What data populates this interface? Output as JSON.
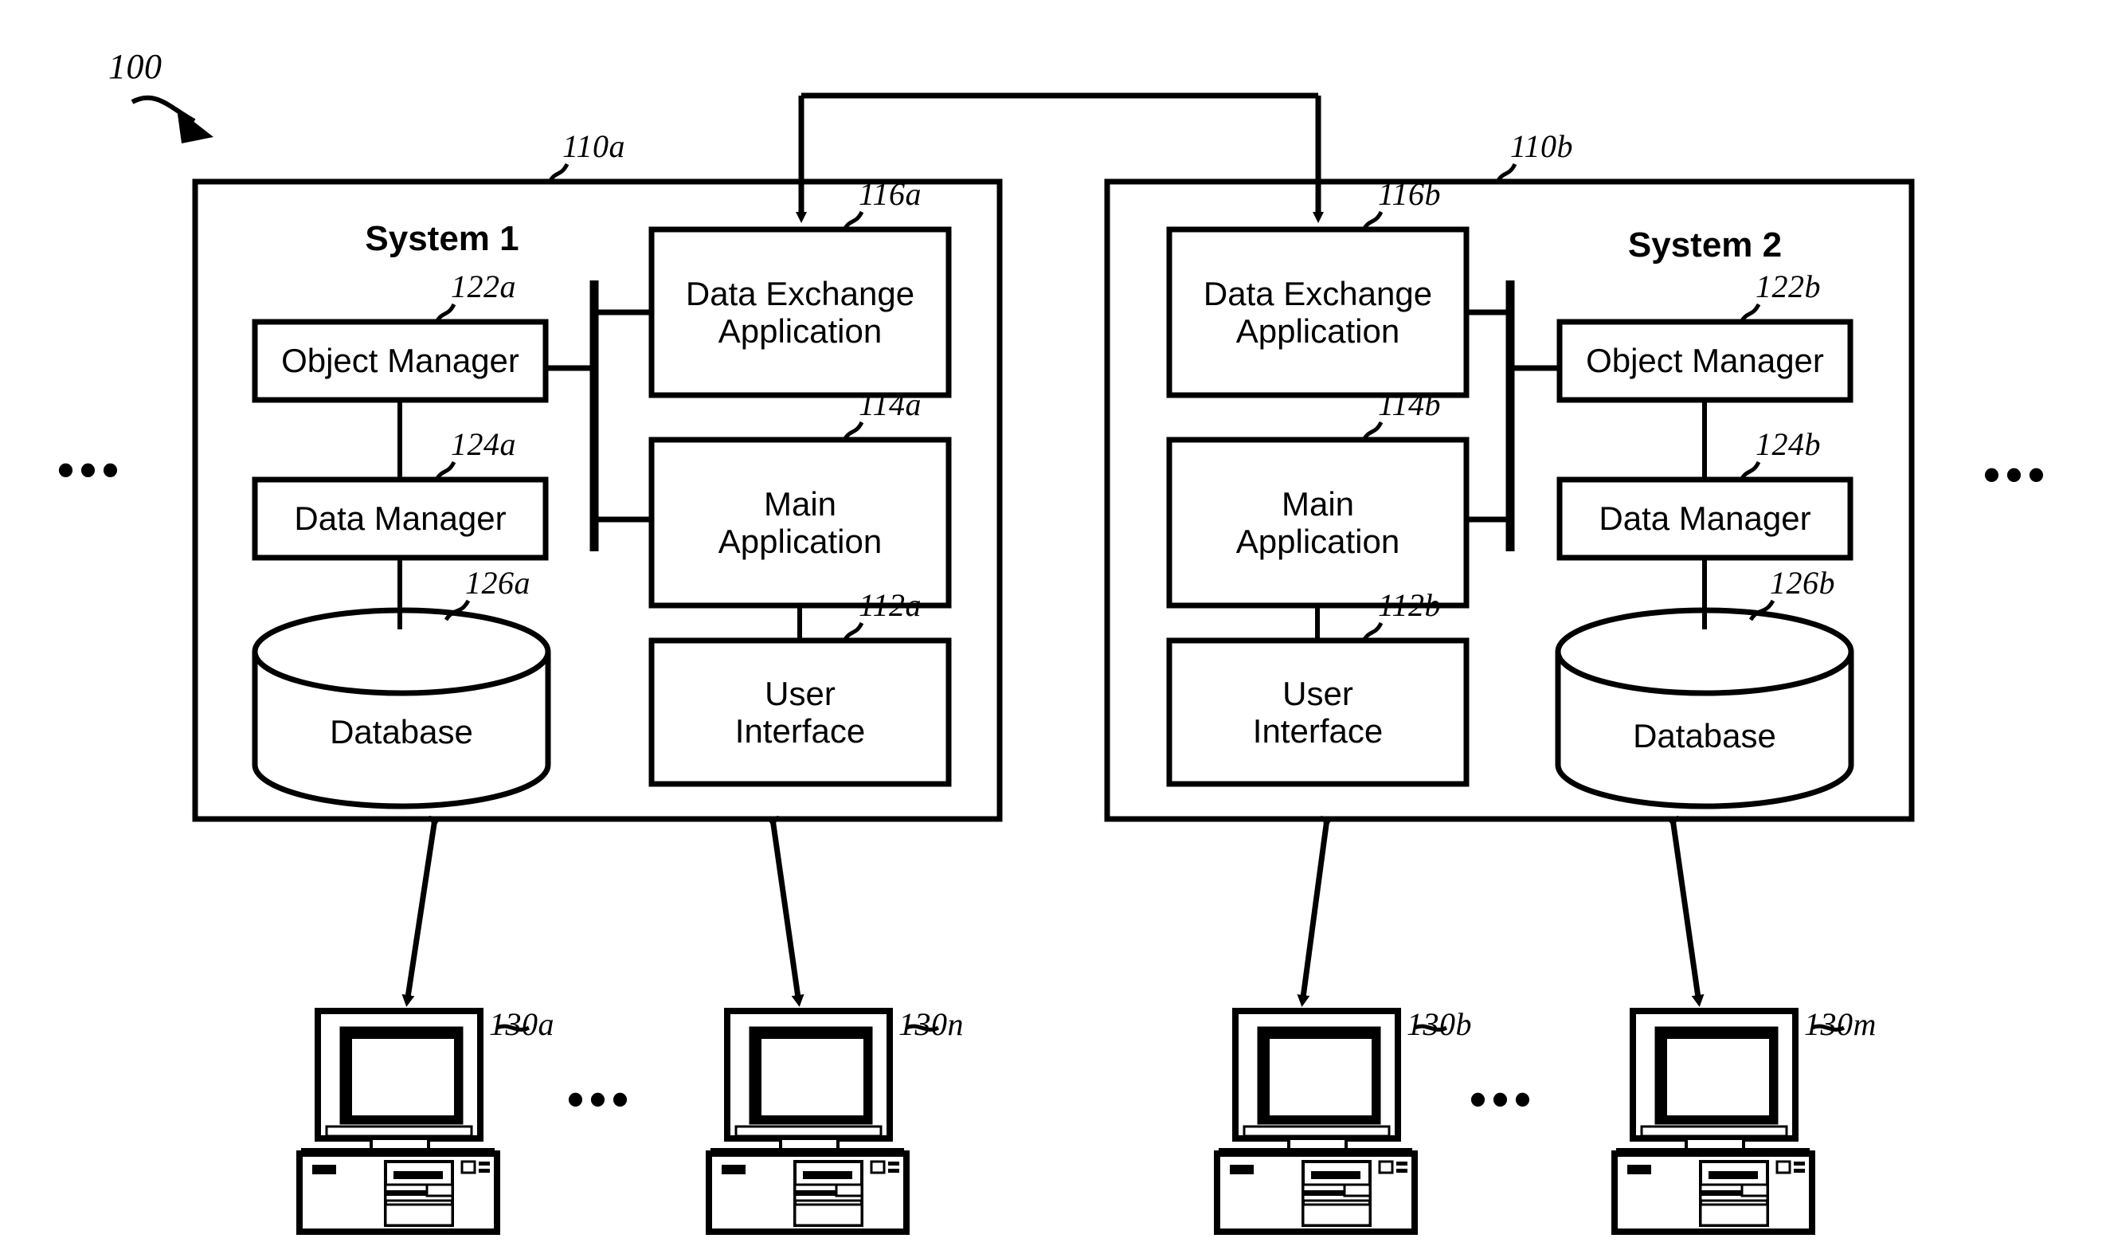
{
  "figure": {
    "reference_numeral": "100",
    "title_label": "100"
  },
  "systems": [
    {
      "id": "system-1",
      "title": "System 1",
      "numeral": "110a",
      "blocks": [
        {
          "id": "object-manager-a",
          "label": "Object Manager",
          "numeral": "122a"
        },
        {
          "id": "data-manager-a",
          "label": "Data Manager",
          "numeral": "124a"
        },
        {
          "id": "database-a",
          "label": "Database",
          "numeral": "126a"
        },
        {
          "id": "data-exchange-application-a",
          "label": "Data Exchange\nApplication",
          "numeral": "116a"
        },
        {
          "id": "main-application-a",
          "label": "Main\nApplication",
          "numeral": "114a"
        },
        {
          "id": "user-interface-a",
          "label": "User\nInterface",
          "numeral": "112a"
        }
      ]
    },
    {
      "id": "system-2",
      "title": "System 2",
      "numeral": "110b",
      "blocks": [
        {
          "id": "data-exchange-application-b",
          "label": "Data Exchange\nApplication",
          "numeral": "116b"
        },
        {
          "id": "main-application-b",
          "label": "Main\nApplication",
          "numeral": "114b"
        },
        {
          "id": "user-interface-b",
          "label": "User\nInterface",
          "numeral": "112b"
        },
        {
          "id": "object-manager-b",
          "label": "Object Manager",
          "numeral": "122b"
        },
        {
          "id": "data-manager-b",
          "label": "Data Manager",
          "numeral": "124b"
        },
        {
          "id": "database-b",
          "label": "Database",
          "numeral": "126b"
        }
      ]
    }
  ],
  "workstations": [
    {
      "id": "workstation-130a",
      "numeral": "130a"
    },
    {
      "id": "workstation-130n",
      "numeral": "130n"
    },
    {
      "id": "workstation-130b",
      "numeral": "130b"
    },
    {
      "id": "workstation-130m",
      "numeral": "130m"
    }
  ],
  "ellipses": [
    {
      "id": "ellipsis-left",
      "text": "•••"
    },
    {
      "id": "ellipsis-right",
      "text": "•••"
    },
    {
      "id": "ellipsis-bottom-left",
      "text": "•••"
    },
    {
      "id": "ellipsis-bottom-right",
      "text": "•••"
    }
  ],
  "colors": {
    "ink": "#000000",
    "paper": "#ffffff"
  }
}
